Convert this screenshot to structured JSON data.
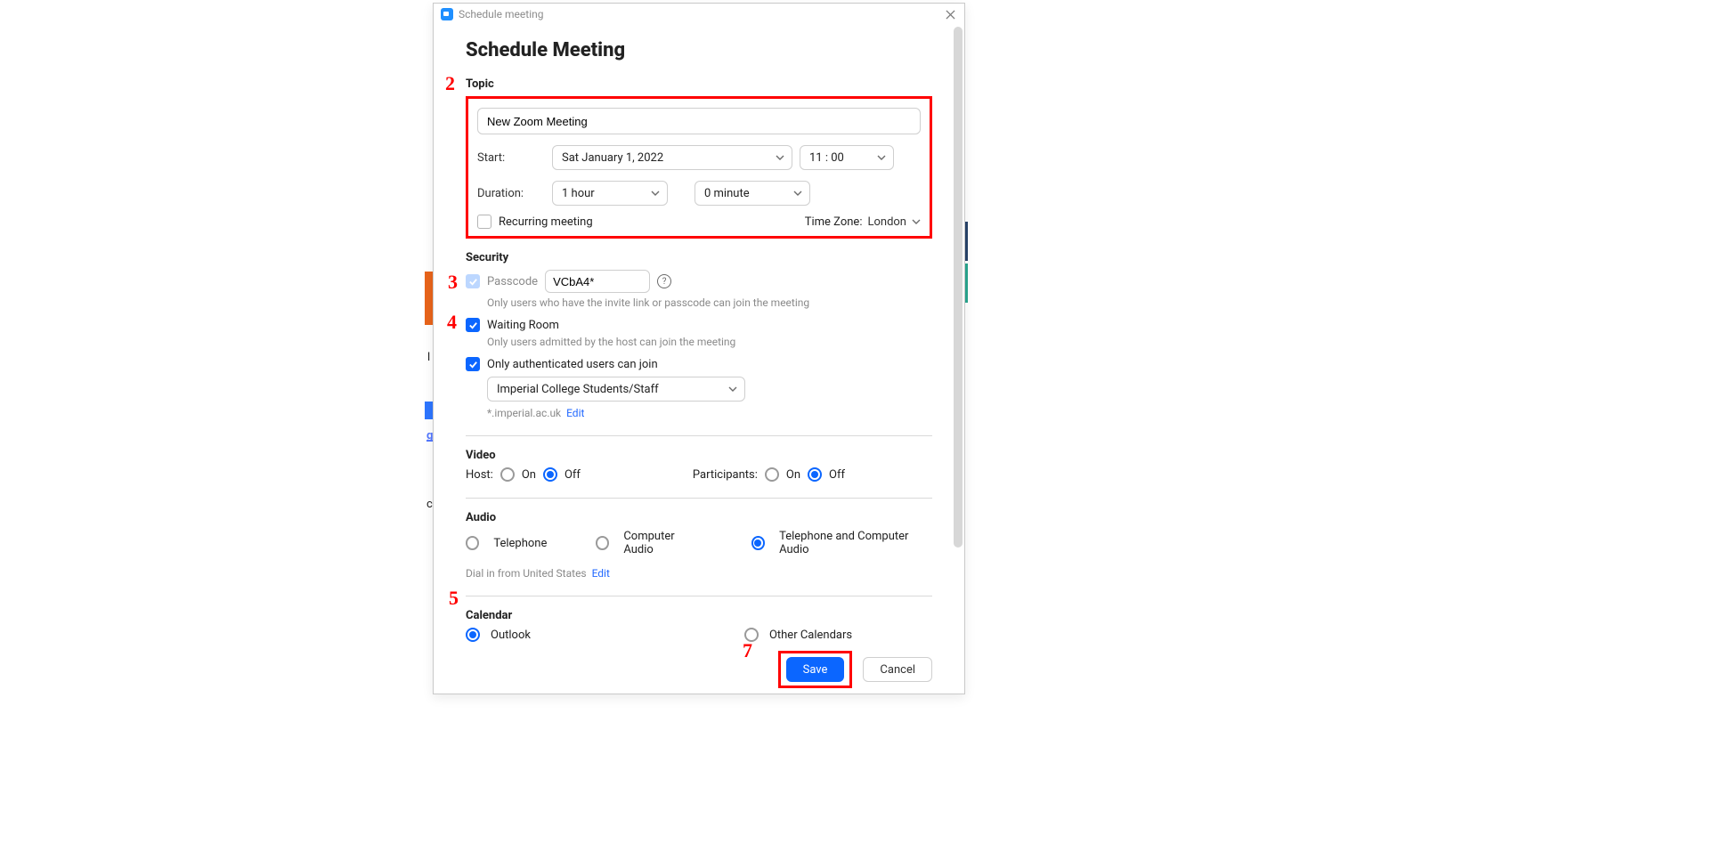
{
  "steps": {
    "s2": "2",
    "s3": "3",
    "s4": "4",
    "s5": "5",
    "s7": "7"
  },
  "window": {
    "title": "Schedule meeting"
  },
  "page": {
    "heading": "Schedule Meeting"
  },
  "topic": {
    "label": "Topic",
    "value": "New Zoom Meeting",
    "start_label": "Start:",
    "date": "Sat  January  1,  2022",
    "time": "11 : 00",
    "duration_label": "Duration:",
    "duration_hours": "1 hour",
    "duration_minutes": "0 minute",
    "recurring_label": "Recurring meeting",
    "timezone_prefix": "Time Zone: ",
    "timezone": "London"
  },
  "security": {
    "label": "Security",
    "passcode_label": "Passcode",
    "passcode_value": "VCbA4*",
    "passcode_hint": "Only users who have the invite link or passcode can join the meeting",
    "waiting_room_label": "Waiting Room",
    "waiting_room_hint": "Only users admitted by the host can join the meeting",
    "auth_label": "Only authenticated users can join",
    "auth_option": "Imperial College Students/Staff",
    "auth_domain": "*.imperial.ac.uk",
    "edit": "Edit"
  },
  "video": {
    "label": "Video",
    "host_label": "Host:",
    "participants_label": "Participants:",
    "on": "On",
    "off": "Off"
  },
  "audio": {
    "label": "Audio",
    "telephone": "Telephone",
    "computer": "Computer Audio",
    "both": "Telephone and Computer Audio",
    "dial_label": "Dial in from United States",
    "edit": "Edit"
  },
  "calendar": {
    "label": "Calendar",
    "outlook": "Outlook",
    "other": "Other Calendars"
  },
  "footer": {
    "save": "Save",
    "cancel": "Cancel"
  }
}
